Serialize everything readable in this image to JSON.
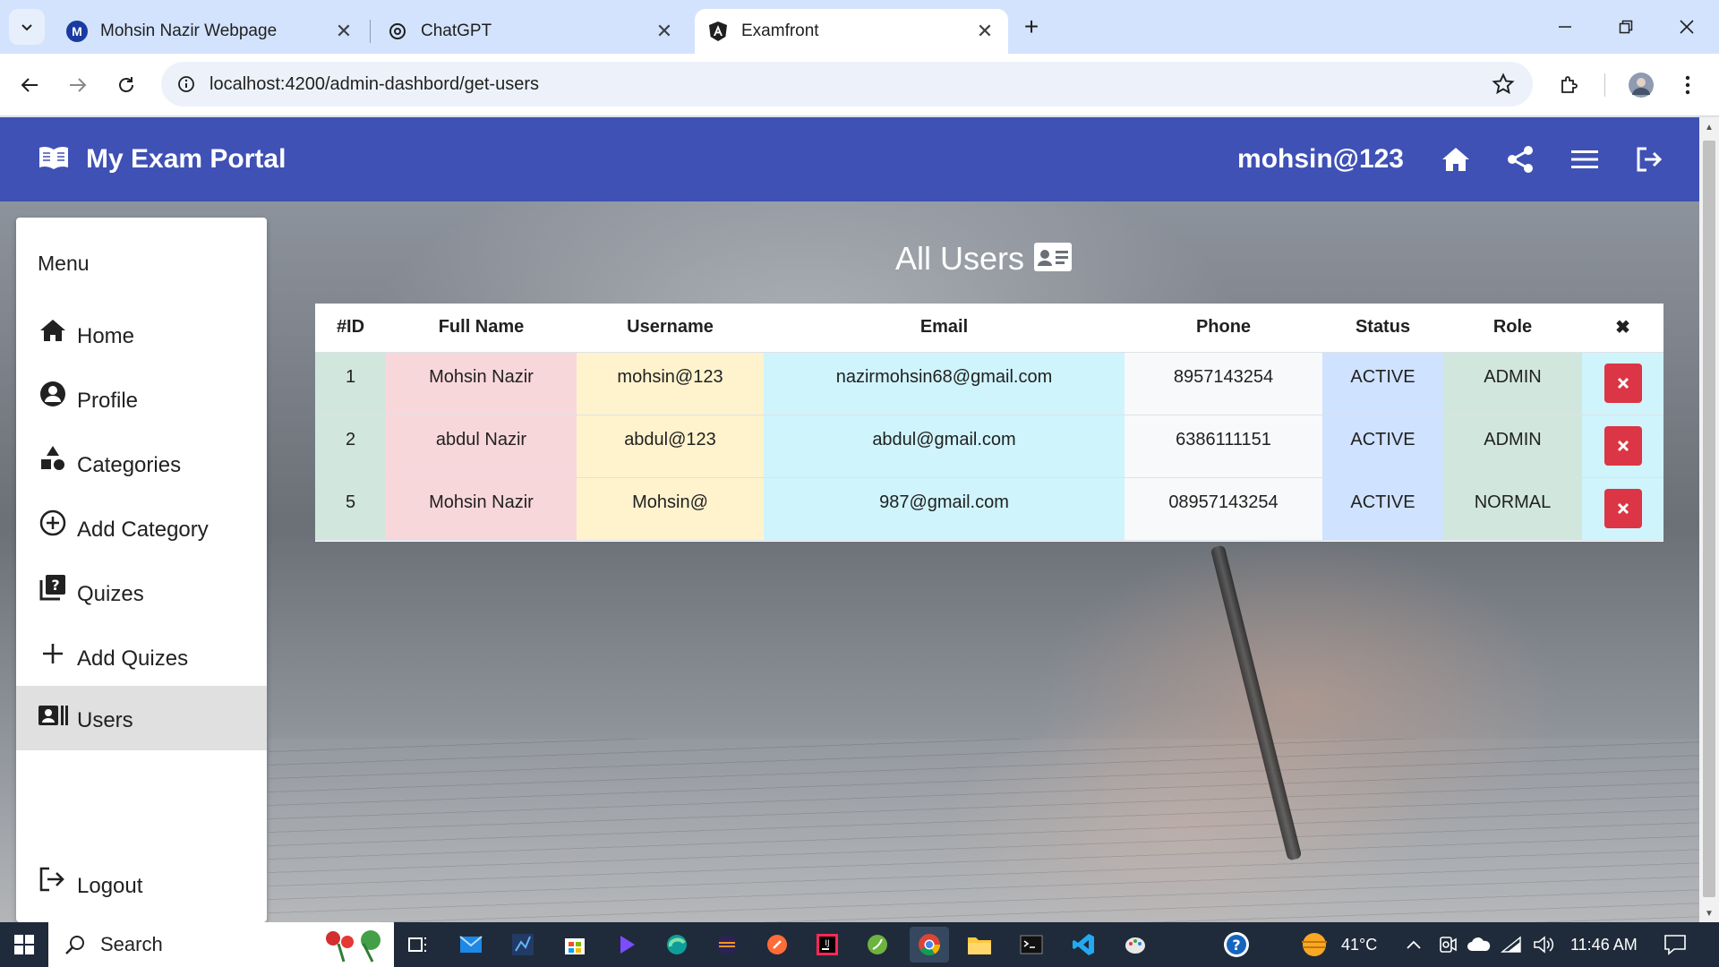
{
  "browser": {
    "tabs": [
      {
        "title": "Mohsin Nazir Webpage",
        "favicon": "M"
      },
      {
        "title": "ChatGPT",
        "favicon": "chatgpt-icon"
      },
      {
        "title": "Examfront",
        "favicon": "angular-icon"
      }
    ],
    "url": "localhost:4200/admin-dashbord/get-users"
  },
  "header": {
    "title": "My Exam Portal",
    "username": "mohsin@123"
  },
  "sidebar": {
    "title": "Menu",
    "items": [
      {
        "label": "Home",
        "icon": "home-icon"
      },
      {
        "label": "Profile",
        "icon": "account-circle-icon"
      },
      {
        "label": "Categories",
        "icon": "category-icon"
      },
      {
        "label": "Add Category",
        "icon": "add-circle-icon"
      },
      {
        "label": "Quizes",
        "icon": "quiz-icon"
      },
      {
        "label": "Add Quizes",
        "icon": "plus-icon"
      },
      {
        "label": "Users",
        "icon": "users-icon",
        "active": true
      },
      {
        "label": "Logout",
        "icon": "logout-icon"
      }
    ]
  },
  "main": {
    "heading": "All Users",
    "table": {
      "headers": [
        "#ID",
        "Full Name",
        "Username",
        "Email",
        "Phone",
        "Status",
        "Role",
        "✖"
      ],
      "rows": [
        [
          "1",
          "Mohsin Nazir",
          "mohsin@123",
          "nazirmohsin68@gmail.com",
          "8957143254",
          "ACTIVE",
          "ADMIN"
        ],
        [
          "2",
          "abdul Nazir",
          "abdul@123",
          "abdul@gmail.com",
          "6386111151",
          "ACTIVE",
          "ADMIN"
        ],
        [
          "5",
          "Mohsin Nazir",
          "Mohsin@",
          "987@gmail.com",
          "08957143254",
          "ACTIVE",
          "NORMAL"
        ]
      ]
    }
  },
  "taskbar": {
    "search_placeholder": "Search",
    "temperature": "41°C",
    "time": "11:46 AM"
  },
  "colors": {
    "appbar": "#3f51b5",
    "delete": "#dc3545"
  }
}
